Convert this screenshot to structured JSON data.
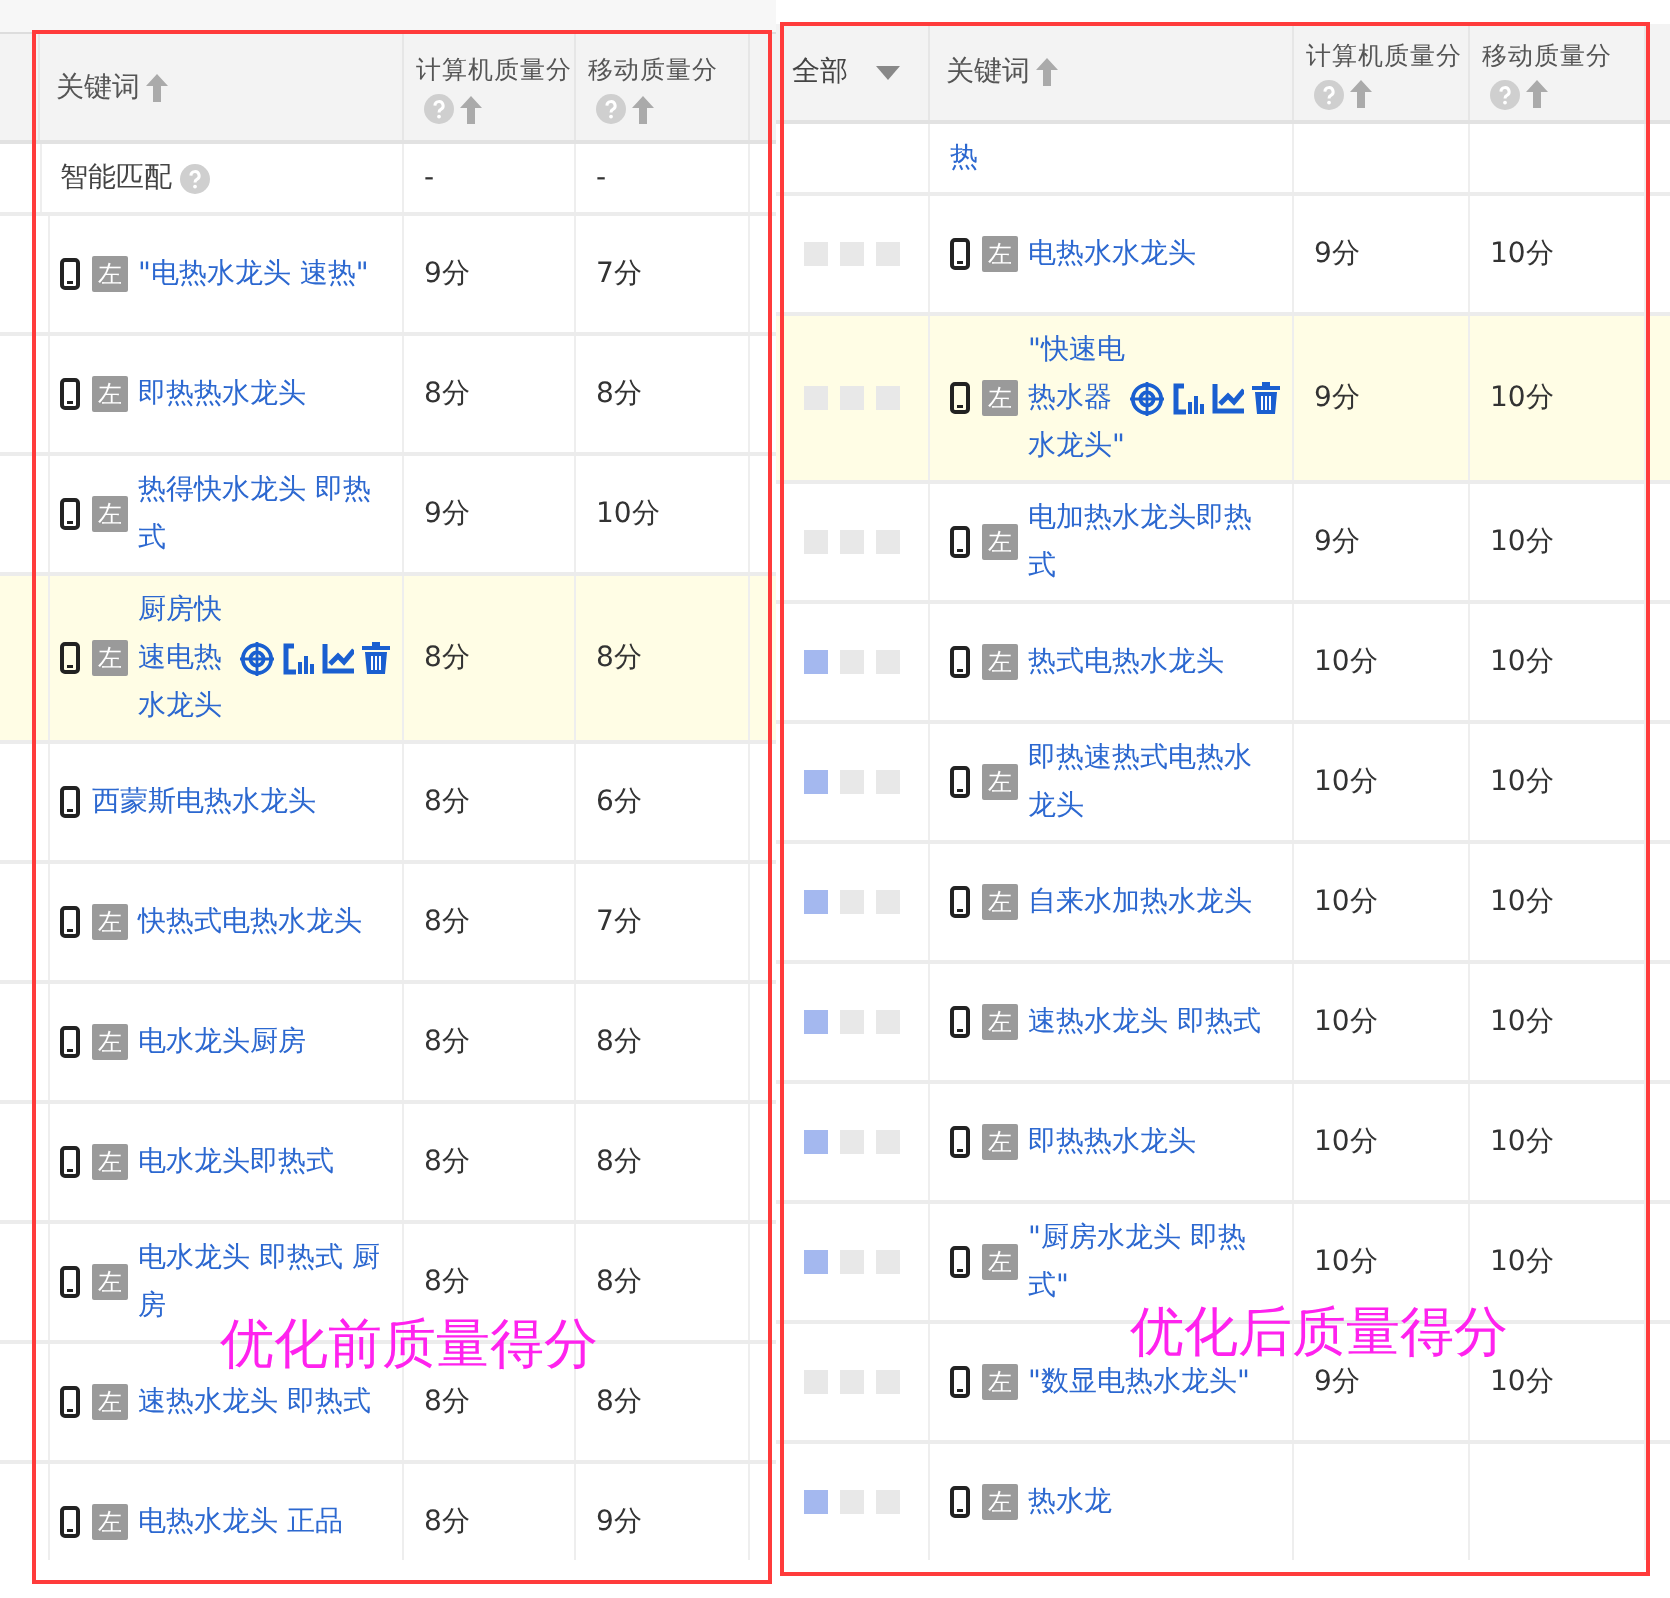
{
  "panels": [
    {
      "kind": "before",
      "columns": [
        {
          "label": "关键词",
          "help": false,
          "sort": true
        },
        {
          "label": "计算机质量分",
          "help": true,
          "sort": true
        },
        {
          "label": "移动质量分",
          "help": true,
          "sort": true
        }
      ],
      "rows": [
        {
          "kind": "smart",
          "keyword": "智能匹配",
          "pc": "-",
          "mobile": "-"
        },
        {
          "kind": "keyword",
          "badge": "左",
          "keyword": "\"电热水龙头 速热\"",
          "pc": "9分",
          "mobile": "7分",
          "highlighted": false
        },
        {
          "kind": "keyword",
          "badge": "左",
          "keyword": "即热热水龙头",
          "pc": "8分",
          "mobile": "8分",
          "highlighted": false
        },
        {
          "kind": "keyword",
          "badge": "左",
          "keyword": "热得快水龙头 即热式",
          "pc": "9分",
          "mobile": "10分",
          "highlighted": false
        },
        {
          "kind": "keyword",
          "badge": "左",
          "keyword": "厨房快速电热水龙头",
          "pc": "8分",
          "mobile": "8分",
          "highlighted": true
        },
        {
          "kind": "keyword",
          "keyword": "西蒙斯电热水龙头",
          "pc": "8分",
          "mobile": "6分",
          "highlighted": false
        },
        {
          "kind": "keyword",
          "badge": "左",
          "keyword": "快热式电热水龙头",
          "pc": "8分",
          "mobile": "7分",
          "highlighted": false
        },
        {
          "kind": "keyword",
          "badge": "左",
          "keyword": "电水龙头厨房",
          "pc": "8分",
          "mobile": "8分",
          "highlighted": false
        },
        {
          "kind": "keyword",
          "badge": "左",
          "keyword": "电水龙头即热式",
          "pc": "8分",
          "mobile": "8分",
          "highlighted": false
        },
        {
          "kind": "keyword",
          "badge": "左",
          "keyword": "电水龙头 即热式 厨房",
          "pc": "8分",
          "mobile": "8分",
          "highlighted": false
        },
        {
          "kind": "keyword",
          "badge": "左",
          "keyword": "速热水龙头 即热式",
          "pc": "8分",
          "mobile": "8分",
          "highlighted": false
        },
        {
          "kind": "keyword",
          "badge": "左",
          "keyword": "电热水龙头 正品",
          "pc": "8分",
          "mobile": "9分",
          "highlighted": false
        }
      ],
      "annotation": "优化前质量得分"
    },
    {
      "kind": "after",
      "filter": {
        "label": "全部"
      },
      "columns": [
        {
          "label": "关键词",
          "help": false,
          "sort": true
        },
        {
          "label": "计算机质量分",
          "help": true,
          "sort": true
        },
        {
          "label": "移动质量分",
          "help": true,
          "sort": true
        }
      ],
      "rows": [
        {
          "kind": "fragment",
          "keyword": "热"
        },
        {
          "kind": "keyword",
          "stars": 0,
          "badge": "左",
          "keyword": "电热水水龙头",
          "pc": "9分",
          "mobile": "10分",
          "highlighted": false
        },
        {
          "kind": "keyword",
          "stars": 0,
          "badge": "左",
          "keyword": "\"快速电热水器水龙头\"",
          "pc": "9分",
          "mobile": "10分",
          "highlighted": true
        },
        {
          "kind": "keyword",
          "stars": 0,
          "badge": "左",
          "keyword": "电加热水龙头即热式",
          "pc": "9分",
          "mobile": "10分",
          "highlighted": false
        },
        {
          "kind": "keyword",
          "stars": 1,
          "badge": "左",
          "keyword": "热式电热水龙头",
          "pc": "10分",
          "mobile": "10分",
          "highlighted": false
        },
        {
          "kind": "keyword",
          "stars": 1,
          "badge": "左",
          "keyword": "即热速热式电热水龙头",
          "pc": "10分",
          "mobile": "10分",
          "highlighted": false
        },
        {
          "kind": "keyword",
          "stars": 1,
          "badge": "左",
          "keyword": "自来水加热水龙头",
          "pc": "10分",
          "mobile": "10分",
          "highlighted": false
        },
        {
          "kind": "keyword",
          "stars": 1,
          "badge": "左",
          "keyword": "速热水龙头 即热式",
          "pc": "10分",
          "mobile": "10分",
          "highlighted": false
        },
        {
          "kind": "keyword",
          "stars": 1,
          "badge": "左",
          "keyword": "即热热水龙头",
          "pc": "10分",
          "mobile": "10分",
          "highlighted": false
        },
        {
          "kind": "keyword",
          "stars": 1,
          "badge": "左",
          "keyword": "\"厨房水龙头 即热式\"",
          "pc": "10分",
          "mobile": "10分",
          "highlighted": false
        },
        {
          "kind": "keyword",
          "stars": 0,
          "badge": "左",
          "keyword": "\"数显电热水龙头\"",
          "pc": "9分",
          "mobile": "10分",
          "highlighted": false
        },
        {
          "kind": "keyword",
          "stars": 1,
          "badge": "左",
          "keyword": "热水龙",
          "highlighted": false
        }
      ],
      "annotation": "优化后质量得分"
    }
  ]
}
